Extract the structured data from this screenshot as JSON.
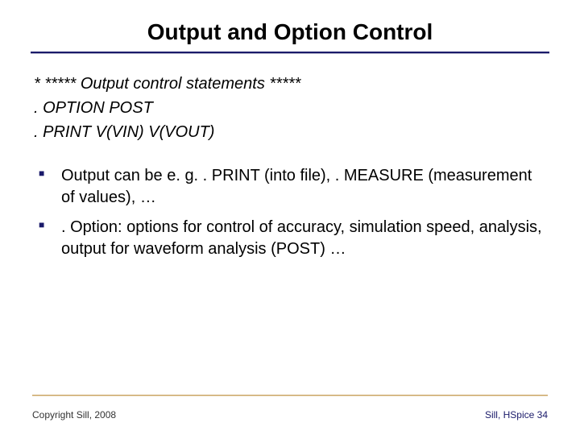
{
  "title": "Output and Option Control",
  "code": {
    "line1": "* ***** Output control statements *****",
    "line2": ". OPTION POST",
    "line3": ". PRINT V(VIN) V(VOUT)"
  },
  "bullets": {
    "b1": "Output can be e. g. . PRINT (into file), . MEASURE (measurement of values), …",
    "b2": ". Option: options for control of accuracy, simulation speed, analysis, output for waveform analysis (POST) …"
  },
  "footer": {
    "copyright": "Copyright Sill, 2008",
    "right_label": "Sill, HSpice",
    "page": "34"
  }
}
